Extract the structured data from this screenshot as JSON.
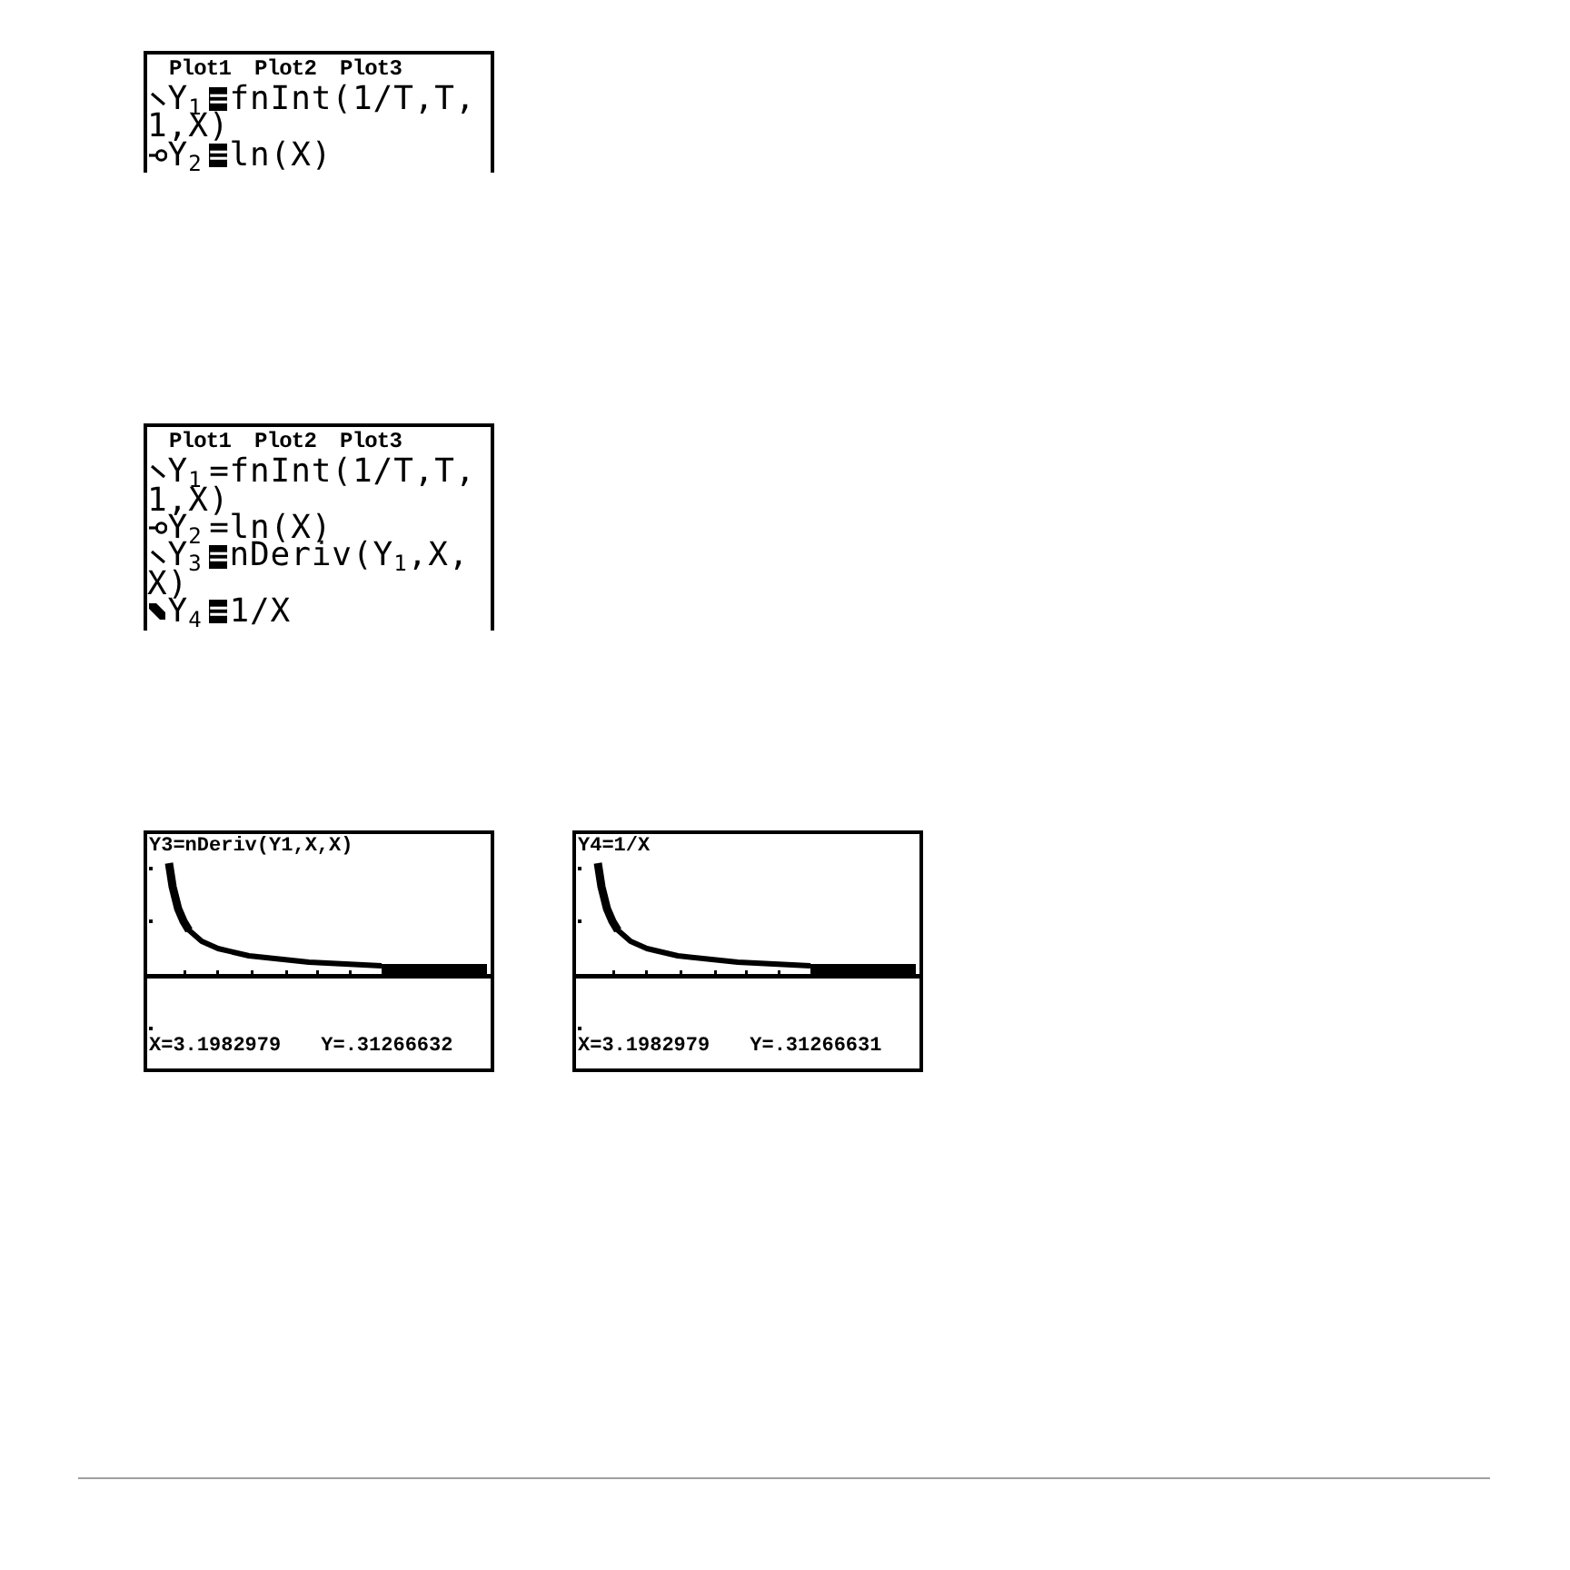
{
  "y_editor_screens": [
    {
      "plots": [
        "Plot1",
        "Plot2",
        "Plot3"
      ],
      "functions": [
        {
          "name": "Y$_{1}$",
          "kind": "line",
          "sign": "=",
          "selected": true,
          "lines": [
            "fnInt(1/T,T,",
            "1,X)"
          ]
        },
        {
          "name": "Y$_{2}$",
          "kind": "path",
          "sign": "=",
          "selected": true,
          "lines": [
            "ln(X)"
          ]
        }
      ]
    },
    {
      "plots": [
        "Plot1",
        "Plot2",
        "Plot3"
      ],
      "functions": [
        {
          "name": "Y$_{1}$",
          "kind": "line",
          "sign": "=",
          "selected": false,
          "lines": [
            "fnInt(1/T,T,",
            "1,X)"
          ]
        },
        {
          "name": "Y$_{2}$",
          "kind": "path",
          "sign": "=",
          "selected": false,
          "lines": [
            "ln(X)"
          ]
        },
        {
          "name": "Y$_{3}$",
          "kind": "line",
          "sign": "=",
          "selected": true,
          "lines": [
            "nDeriv(Y$_{1}$,X,",
            "X)"
          ]
        },
        {
          "name": "Y$_{4}$",
          "kind": "thick",
          "sign": "=",
          "selected": true,
          "lines": [
            "1/X"
          ]
        }
      ]
    }
  ],
  "graph_screens": [
    {
      "title": "Y3=nDeriv(Y1,X,X)",
      "x_readout": "X=3.1982979",
      "y_readout": "Y=.31266632"
    },
    {
      "title": "Y4=1/X",
      "x_readout": "X=3.1982979",
      "y_readout": "Y=.31266631"
    }
  ]
}
